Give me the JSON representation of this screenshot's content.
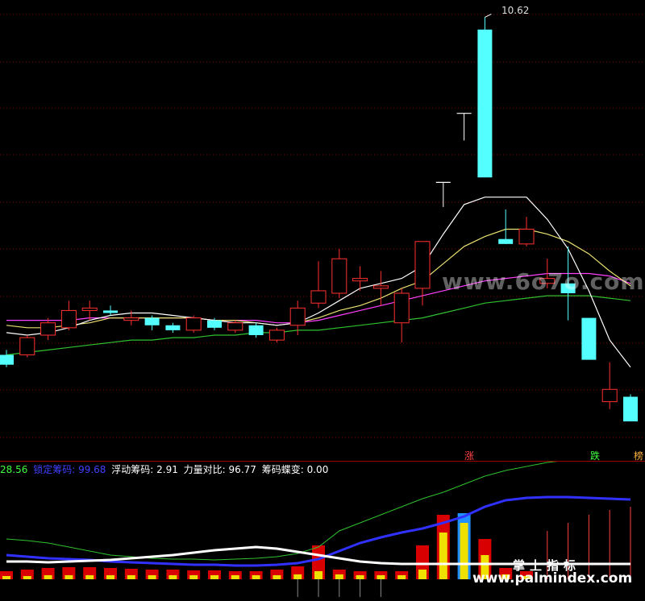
{
  "price_marker": {
    "high_label": "10.62"
  },
  "indicator_bar": {
    "first_value": "28.56",
    "locked_label": "锁定筹码:",
    "locked_value": "99.68",
    "floating_label": "浮动筹码:",
    "floating_value": "2.91",
    "strength_label": "力量对比:",
    "strength_value": "96.77",
    "butterfly_label": "筹码蝶变:",
    "butterfly_value": "0.00"
  },
  "signal_tags": {
    "rise": "涨",
    "fall": "跌",
    "third": "榜"
  },
  "watermarks": {
    "site1": "www.6o7o.com",
    "brand": "掌上指标",
    "site2": "www.palmindex.com"
  },
  "colors": {
    "background": "#000000",
    "up_candle": "#ff3030",
    "down_candle": "#54ffff",
    "ma_white": "#ffffff",
    "ma_yellow": "#e8e070",
    "ma_magenta": "#ff40ff",
    "ma_green": "#30c030",
    "grid": "#8a0000",
    "locked_blue": "#3030ff"
  },
  "candles": [
    {
      "o": 9.21,
      "c": 9.25,
      "h": 9.27,
      "l": 9.2,
      "up": false
    },
    {
      "o": 9.25,
      "c": 9.32,
      "h": 9.33,
      "l": 9.24,
      "up": true
    },
    {
      "o": 9.33,
      "c": 9.38,
      "h": 9.4,
      "l": 9.31,
      "up": true
    },
    {
      "o": 9.36,
      "c": 9.43,
      "h": 9.47,
      "l": 9.35,
      "up": true
    },
    {
      "o": 9.43,
      "c": 9.44,
      "h": 9.47,
      "l": 9.39,
      "up": true
    },
    {
      "o": 9.43,
      "c": 9.42,
      "h": 9.45,
      "l": 9.41,
      "up": false
    },
    {
      "o": 9.4,
      "c": 9.39,
      "h": 9.43,
      "l": 9.37,
      "up": true
    },
    {
      "o": 9.4,
      "c": 9.37,
      "h": 9.41,
      "l": 9.35,
      "up": false
    },
    {
      "o": 9.37,
      "c": 9.35,
      "h": 9.38,
      "l": 9.34,
      "up": false
    },
    {
      "o": 9.35,
      "c": 9.4,
      "h": 9.41,
      "l": 9.34,
      "up": true
    },
    {
      "o": 9.39,
      "c": 9.36,
      "h": 9.4,
      "l": 9.35,
      "up": false
    },
    {
      "o": 9.35,
      "c": 9.38,
      "h": 9.39,
      "l": 9.34,
      "up": true
    },
    {
      "o": 9.37,
      "c": 9.33,
      "h": 9.38,
      "l": 9.32,
      "up": false
    },
    {
      "o": 9.31,
      "c": 9.35,
      "h": 9.36,
      "l": 9.3,
      "up": true
    },
    {
      "o": 9.37,
      "c": 9.44,
      "h": 9.47,
      "l": 9.33,
      "up": true
    },
    {
      "o": 9.46,
      "c": 9.51,
      "h": 9.63,
      "l": 9.44,
      "up": true
    },
    {
      "o": 9.5,
      "c": 9.64,
      "h": 9.68,
      "l": 9.48,
      "up": true
    },
    {
      "o": 9.55,
      "c": 9.56,
      "h": 9.61,
      "l": 9.51,
      "up": true
    },
    {
      "o": 9.53,
      "c": 9.52,
      "h": 9.59,
      "l": 9.45,
      "up": true
    },
    {
      "o": 9.38,
      "c": 9.5,
      "h": 9.52,
      "l": 9.3,
      "up": true
    },
    {
      "o": 9.52,
      "c": 9.71,
      "h": 9.71,
      "l": 9.45,
      "up": true
    },
    {
      "o": 9.95,
      "c": 9.95,
      "h": 9.95,
      "l": 9.85,
      "up": true
    },
    {
      "o": 10.23,
      "c": 10.23,
      "h": 10.23,
      "l": 10.12,
      "up": true
    },
    {
      "o": 10.57,
      "c": 9.97,
      "h": 10.62,
      "l": 9.97,
      "up": false
    },
    {
      "o": 9.72,
      "c": 9.7,
      "h": 9.84,
      "l": 9.7,
      "up": false
    },
    {
      "o": 9.7,
      "c": 9.76,
      "h": 9.81,
      "l": 9.69,
      "up": true
    },
    {
      "o": 9.56,
      "c": 9.54,
      "h": 9.64,
      "l": 9.52,
      "up": true
    },
    {
      "o": 9.54,
      "c": 9.5,
      "h": 9.69,
      "l": 9.39,
      "up": false
    },
    {
      "o": 9.4,
      "c": 9.23,
      "h": 9.4,
      "l": 9.23,
      "up": false
    },
    {
      "o": 9.06,
      "c": 9.11,
      "h": 9.22,
      "l": 9.03,
      "up": true
    },
    {
      "o": 9.08,
      "c": 8.98,
      "h": 9.09,
      "l": 8.98,
      "up": false
    }
  ],
  "ma_white": [
    9.34,
    9.33,
    9.34,
    9.36,
    9.39,
    9.41,
    9.42,
    9.42,
    9.41,
    9.4,
    9.39,
    9.38,
    9.38,
    9.37,
    9.38,
    9.42,
    9.47,
    9.52,
    9.54,
    9.56,
    9.61,
    9.74,
    9.86,
    9.89,
    9.89,
    9.89,
    9.8,
    9.68,
    9.51,
    9.31,
    9.2
  ],
  "ma_yellow": [
    9.37,
    9.36,
    9.36,
    9.37,
    9.38,
    9.4,
    9.4,
    9.4,
    9.4,
    9.4,
    9.39,
    9.39,
    9.38,
    9.37,
    9.38,
    9.4,
    9.43,
    9.45,
    9.48,
    9.52,
    9.55,
    9.62,
    9.69,
    9.73,
    9.76,
    9.76,
    9.74,
    9.71,
    9.66,
    9.59,
    9.53
  ],
  "ma_magenta": [
    9.39,
    9.39,
    9.39,
    9.39,
    9.4,
    9.4,
    9.4,
    9.4,
    9.4,
    9.4,
    9.39,
    9.39,
    9.39,
    9.38,
    9.38,
    9.39,
    9.41,
    9.43,
    9.45,
    9.47,
    9.49,
    9.51,
    9.53,
    9.55,
    9.56,
    9.57,
    9.58,
    9.58,
    9.58,
    9.57,
    9.54
  ],
  "ma_green": [
    9.25,
    9.26,
    9.27,
    9.28,
    9.29,
    9.3,
    9.31,
    9.31,
    9.32,
    9.32,
    9.33,
    9.33,
    9.34,
    9.34,
    9.35,
    9.35,
    9.36,
    9.37,
    9.38,
    9.39,
    9.4,
    9.42,
    9.44,
    9.46,
    9.47,
    9.48,
    9.49,
    9.49,
    9.49,
    9.48,
    9.47
  ],
  "locked_line": [
    30,
    28,
    26,
    25,
    24,
    22,
    21,
    20,
    19,
    18,
    18,
    17,
    17,
    18,
    20,
    25,
    35,
    45,
    52,
    58,
    63,
    70,
    78,
    90,
    98,
    101,
    102,
    102,
    101,
    100,
    99
  ],
  "green_line": [
    50,
    48,
    45,
    40,
    35,
    30,
    28,
    26,
    25,
    25,
    24,
    25,
    26,
    28,
    32,
    40,
    60,
    70,
    80,
    90,
    100,
    108,
    118,
    128,
    135,
    140,
    145,
    148,
    150,
    149,
    150
  ],
  "white_line": [
    22,
    22,
    21,
    22,
    23,
    24,
    26,
    28,
    30,
    33,
    36,
    38,
    40,
    38,
    34,
    30,
    26,
    22,
    20,
    19,
    19,
    19,
    19,
    19,
    19,
    19,
    19,
    19,
    19,
    19,
    19
  ],
  "chip_bars": [
    {
      "h": 10,
      "cut": 4
    },
    {
      "h": 12,
      "cut": 4
    },
    {
      "h": 14,
      "cut": 5
    },
    {
      "h": 15,
      "cut": 5
    },
    {
      "h": 15,
      "cut": 5
    },
    {
      "h": 14,
      "cut": 5
    },
    {
      "h": 13,
      "cut": 5
    },
    {
      "h": 12,
      "cut": 5
    },
    {
      "h": 12,
      "cut": 5
    },
    {
      "h": 11,
      "cut": 5
    },
    {
      "h": 11,
      "cut": 5
    },
    {
      "h": 10,
      "cut": 5
    },
    {
      "h": 10,
      "cut": 5
    },
    {
      "h": 12,
      "cut": 5
    },
    {
      "h": 16,
      "cut": 6
    },
    {
      "h": 42,
      "cut": 10
    },
    {
      "h": 12,
      "cut": 6
    },
    {
      "h": 10,
      "cut": 5
    },
    {
      "h": 10,
      "cut": 5
    },
    {
      "h": 10,
      "cut": 5
    },
    {
      "h": 42,
      "cut": 12
    },
    {
      "h": 80,
      "cut": 58
    },
    {
      "h": 82,
      "cut": 70
    },
    {
      "h": 50,
      "cut": 30
    },
    {
      "h": 14,
      "cut": 6
    },
    {
      "h": 10,
      "cut": 4
    },
    {
      "h": 60,
      "cut": 0
    },
    {
      "h": 70,
      "cut": 0
    },
    {
      "h": 80,
      "cut": 0
    },
    {
      "h": 86,
      "cut": 0
    },
    {
      "h": 90,
      "cut": 0
    }
  ]
}
